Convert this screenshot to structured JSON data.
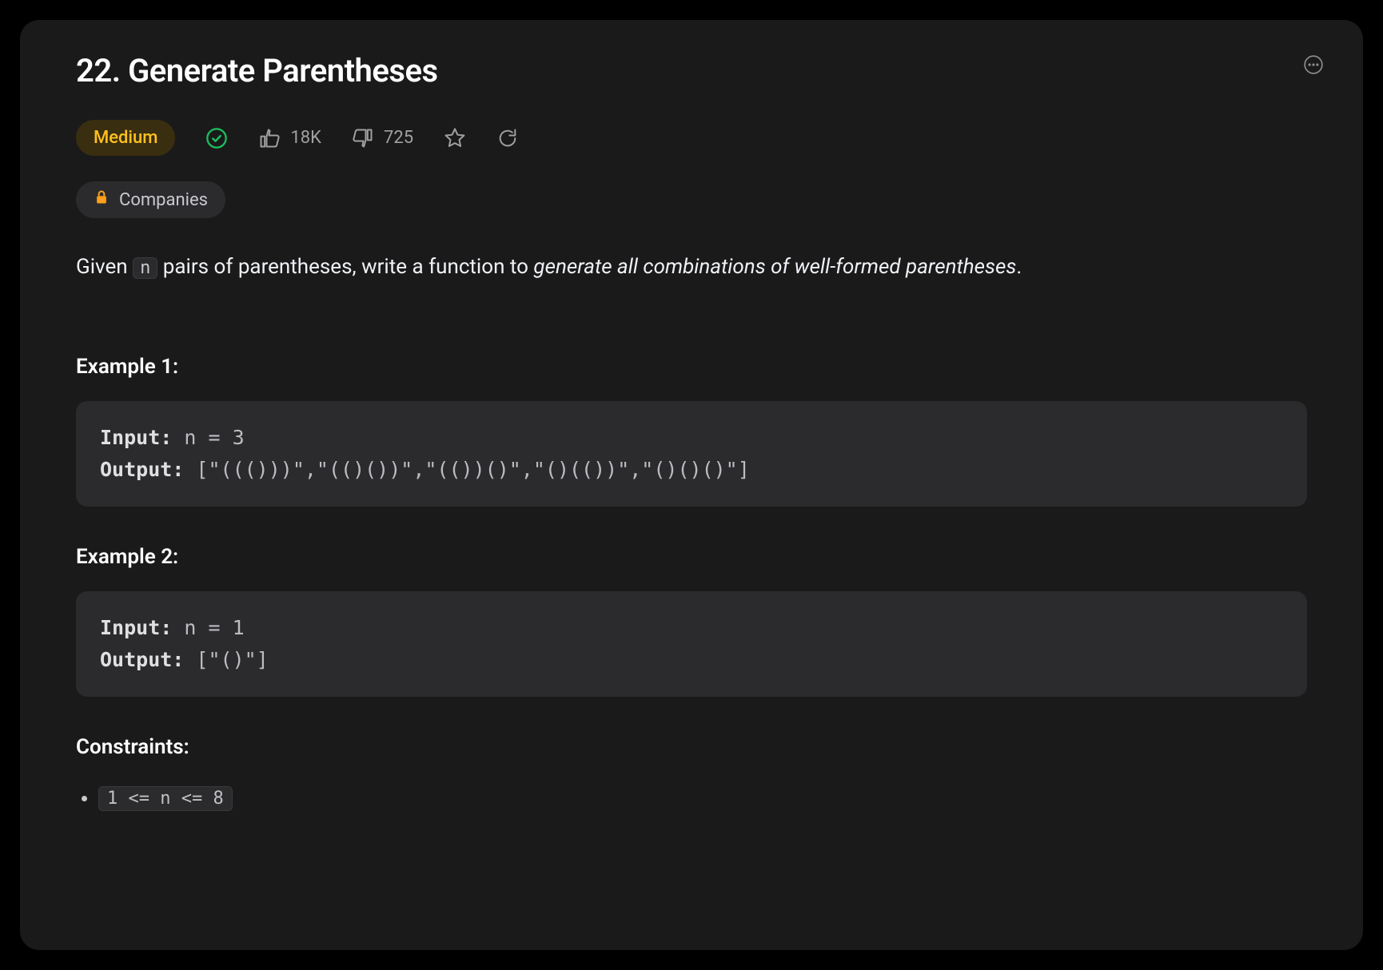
{
  "problem": {
    "title": "22. Generate Parentheses",
    "difficulty": "Medium",
    "likes": "18K",
    "dislikes": "725",
    "companies_label": "Companies",
    "description_prefix": "Given ",
    "description_code": "n",
    "description_mid": " pairs of parentheses, write a function to ",
    "description_em": "generate all combinations of well-formed parentheses",
    "description_suffix": "."
  },
  "examples": [
    {
      "heading": "Example 1:",
      "input_label": "Input:",
      "input_value": " n = 3",
      "output_label": "Output:",
      "output_value": " [\"((()))\",\"(()())\",\"(())()\",\"()(())\",\"()()()\"]"
    },
    {
      "heading": "Example 2:",
      "input_label": "Input:",
      "input_value": " n = 1",
      "output_label": "Output:",
      "output_value": " [\"()\"]"
    }
  ],
  "constraints": {
    "heading": "Constraints:",
    "items": [
      "1 <= n <= 8"
    ]
  }
}
